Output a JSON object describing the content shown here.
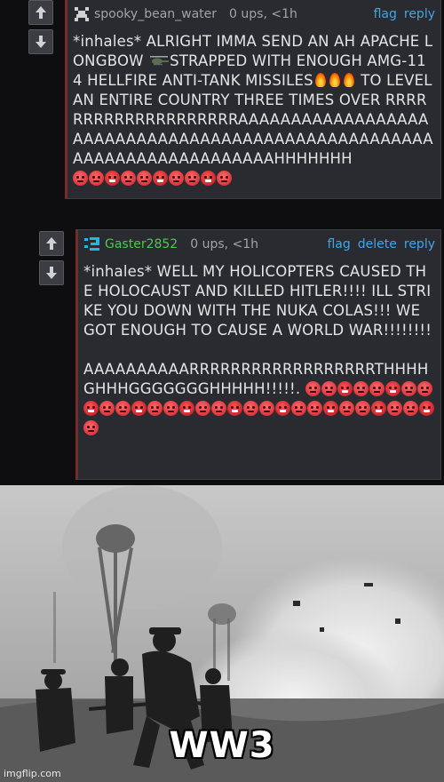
{
  "comment1": {
    "username": "spooky_bean_water",
    "meta": "0 ups, <1h",
    "actions": [
      "flag",
      "reply"
    ],
    "text_a": "*inhales* ALRIGHT IMMA SEND AN AH APACHE LONGBOW ",
    "text_b": "STRAPPED WITH ENOUGH AMG-114 HELLFIRE ANTI-TANK MISSILES",
    "text_c": " TO LEVEL AN ENTIRE COUNTRY THREE TIMES OVER RRRRRRRRRRRRRRRRRRRRAAAAAAAAAAAAAAAAAAAAAAAAAAAAAAAAAAAAAAAAAAAAAAAAAAAAAAAAAAAAAAAAAAAAAAAHHHHHHH",
    "emoji_count": 10
  },
  "comment2": {
    "username": "Gaster2852",
    "meta": "0 ups, <1h",
    "actions": [
      "flag",
      "delete",
      "reply"
    ],
    "text_a": "*inhales* WELL MY HOLICOPTERS CAUSED THE HOLOCAUST AND KILLED HITLER!!!! ILL STRIKE YOU DOWN WITH THE NUKA COLAS!!! WE GOT ENOUGH TO CAUSE A WORLD WAR!!!!!!!!",
    "text_b": "AAAAAAAAAARRRRRRRRRRRRRRRRRRTHHHHGHHHGGGGGGGHHHHH!!!!!. ",
    "emoji_count": 31
  },
  "meme": {
    "caption": "WW3",
    "watermark": "imgflip.com"
  }
}
